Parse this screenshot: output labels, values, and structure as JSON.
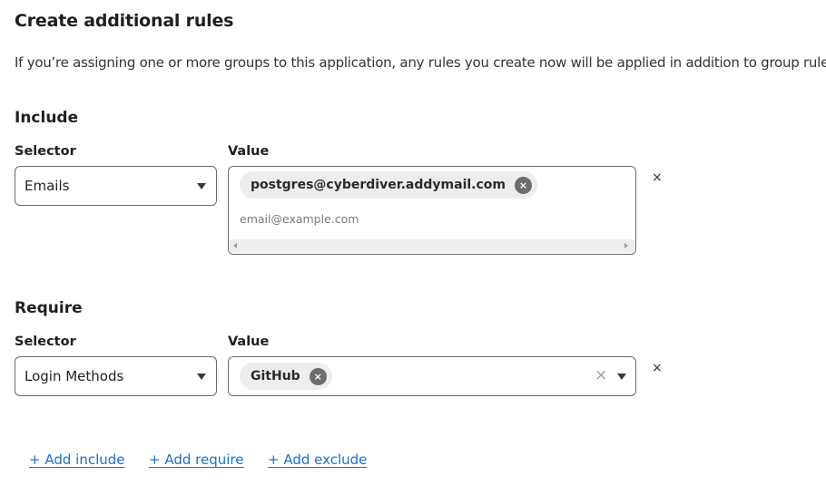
{
  "page": {
    "title": "Create additional rules",
    "description": "If you’re assigning one or more groups to this application, any rules you create now will be applied in addition to group rules."
  },
  "include": {
    "heading": "Include",
    "selector_label": "Selector",
    "value_label": "Value",
    "selector_value": "Emails",
    "chips": [
      "postgres@cyberdiver.addymail.com"
    ],
    "input_placeholder": "email@example.com",
    "remove_row_glyph": "×",
    "chip_remove_glyph": "×"
  },
  "require": {
    "heading": "Require",
    "selector_label": "Selector",
    "value_label": "Value",
    "selector_value": "Login Methods",
    "chips": [
      "GitHub"
    ],
    "clear_glyph": "×",
    "remove_row_glyph": "×",
    "chip_remove_glyph": "×"
  },
  "actions": {
    "add_include": "+ Add include",
    "add_require": "+ Add require",
    "add_exclude": "+ Add exclude"
  },
  "colors": {
    "link": "#1a6fd1",
    "chip_background": "#ededed",
    "chip_remove_background": "#6d6d6d"
  },
  "icons": {
    "dropdown": "caret-down-icon",
    "chip_remove": "close-circle-icon",
    "row_remove": "close-icon",
    "clear": "clear-icon"
  }
}
